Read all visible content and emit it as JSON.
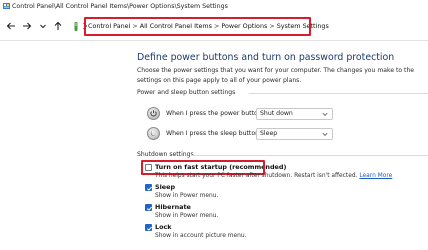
{
  "window": {
    "title": "Control Panel\\All Control Panel Items\\Power Options\\System Settings"
  },
  "address": {
    "breadcrumbs": [
      "Control Panel",
      "All Control Panel Items",
      "Power Options",
      "System Settings"
    ],
    "separator": ">"
  },
  "main": {
    "heading": "Define power buttons and turn on password protection",
    "description": "Choose the power settings that you want for your computer. The changes you make to the settings on this page apply to all of your power plans.",
    "power_section": {
      "label": "Power and sleep button settings",
      "rows": [
        {
          "label": "When I press the power button:",
          "value": "Shut down"
        },
        {
          "label": "When I press the sleep button:",
          "value": "Sleep"
        }
      ]
    },
    "shutdown_section": {
      "label": "Shutdown settings",
      "options": [
        {
          "label": "Turn on fast startup (recommended)",
          "checked": false,
          "description": "This helps start your PC faster after shutdown. Restart isn't affected.",
          "link": "Learn More"
        },
        {
          "label": "Sleep",
          "checked": true,
          "description": "Show in Power menu."
        },
        {
          "label": "Hibernate",
          "checked": true,
          "description": "Show in Power menu."
        },
        {
          "label": "Lock",
          "checked": true,
          "description": "Show in account picture menu."
        }
      ]
    }
  },
  "colors": {
    "highlight": "#d81c2b",
    "heading": "#1e3b70",
    "checkbox": "#1f66c7",
    "link": "#1f5fbf"
  }
}
